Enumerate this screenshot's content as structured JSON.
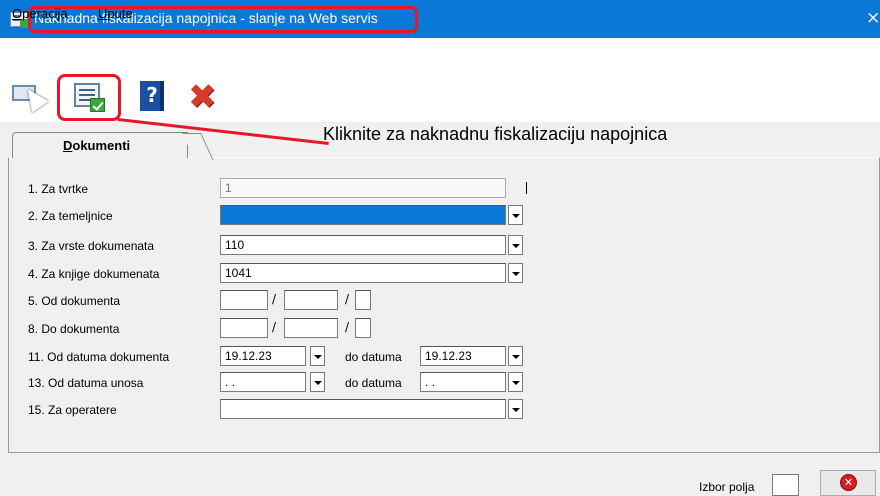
{
  "window": {
    "title": "Naknadna fiskalizacija napojnica - slanje na Web servis",
    "close_icon": "×"
  },
  "menu": {
    "items": [
      {
        "first": "O",
        "rest": "peracija"
      },
      {
        "first": "U",
        "rest": "pute"
      }
    ]
  },
  "toolbar": {
    "icons": [
      "pointer-icon",
      "fiscalize-tips-icon",
      "help-book-icon",
      "delete-x-icon"
    ],
    "help_glyph": "?",
    "delete_glyph": "✖"
  },
  "callout": {
    "text": "Kliknite za naknadnu fiskalizaciju napojnica"
  },
  "tab": {
    "first": "D",
    "rest": "okumenti"
  },
  "form": {
    "za_tvrtke": {
      "label": "1. Za tvrtke",
      "value": "1"
    },
    "za_temeljnice": {
      "label": "2. Za temeljnice",
      "value": ""
    },
    "za_vrste": {
      "label": "3. Za vrste dokumenata",
      "value": "110"
    },
    "za_knjige": {
      "label": "4. Za knjige dokumenata",
      "value": "1041"
    },
    "od_dokumenta": {
      "label": "5. Od dokumenta",
      "slash": "/"
    },
    "do_dokumenta": {
      "label": "8. Do dokumenta",
      "slash": "/"
    },
    "od_datuma_dok": {
      "label": "11. Od datuma dokumenta",
      "value": "19.12.23",
      "to_label": "do datuma",
      "to_value": "19.12.23"
    },
    "od_datuma_unosa": {
      "label": "13. Od datuma unosa",
      "value": " . .",
      "to_label": "do datuma",
      "to_value": " . ."
    },
    "za_operatere": {
      "label": "15. Za operatere",
      "value": ""
    }
  },
  "footer": {
    "izbor_label": "Izbor polja",
    "cancel_glyph": "✕"
  },
  "colors": {
    "titlebar": "#0a78d7",
    "highlight": "#e8162a"
  }
}
